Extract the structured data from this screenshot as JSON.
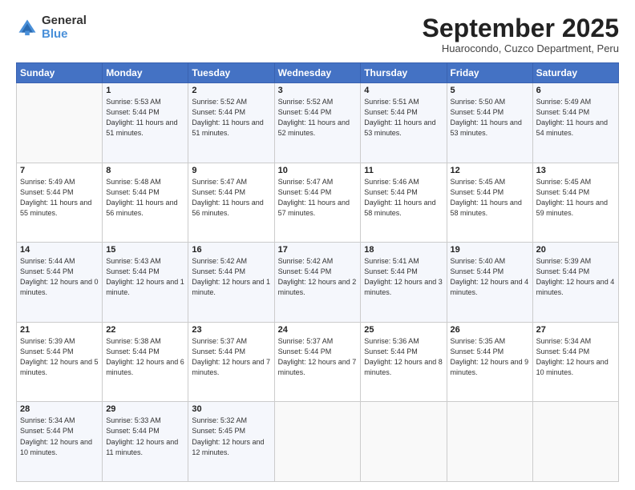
{
  "header": {
    "logo_general": "General",
    "logo_blue": "Blue",
    "month_title": "September 2025",
    "subtitle": "Huarocondo, Cuzco Department, Peru"
  },
  "calendar": {
    "days_of_week": [
      "Sunday",
      "Monday",
      "Tuesday",
      "Wednesday",
      "Thursday",
      "Friday",
      "Saturday"
    ],
    "weeks": [
      [
        {
          "day": "",
          "sunrise": "",
          "sunset": "",
          "daylight": ""
        },
        {
          "day": "1",
          "sunrise": "Sunrise: 5:53 AM",
          "sunset": "Sunset: 5:44 PM",
          "daylight": "Daylight: 11 hours and 51 minutes."
        },
        {
          "day": "2",
          "sunrise": "Sunrise: 5:52 AM",
          "sunset": "Sunset: 5:44 PM",
          "daylight": "Daylight: 11 hours and 51 minutes."
        },
        {
          "day": "3",
          "sunrise": "Sunrise: 5:52 AM",
          "sunset": "Sunset: 5:44 PM",
          "daylight": "Daylight: 11 hours and 52 minutes."
        },
        {
          "day": "4",
          "sunrise": "Sunrise: 5:51 AM",
          "sunset": "Sunset: 5:44 PM",
          "daylight": "Daylight: 11 hours and 53 minutes."
        },
        {
          "day": "5",
          "sunrise": "Sunrise: 5:50 AM",
          "sunset": "Sunset: 5:44 PM",
          "daylight": "Daylight: 11 hours and 53 minutes."
        },
        {
          "day": "6",
          "sunrise": "Sunrise: 5:49 AM",
          "sunset": "Sunset: 5:44 PM",
          "daylight": "Daylight: 11 hours and 54 minutes."
        }
      ],
      [
        {
          "day": "7",
          "sunrise": "Sunrise: 5:49 AM",
          "sunset": "Sunset: 5:44 PM",
          "daylight": "Daylight: 11 hours and 55 minutes."
        },
        {
          "day": "8",
          "sunrise": "Sunrise: 5:48 AM",
          "sunset": "Sunset: 5:44 PM",
          "daylight": "Daylight: 11 hours and 56 minutes."
        },
        {
          "day": "9",
          "sunrise": "Sunrise: 5:47 AM",
          "sunset": "Sunset: 5:44 PM",
          "daylight": "Daylight: 11 hours and 56 minutes."
        },
        {
          "day": "10",
          "sunrise": "Sunrise: 5:47 AM",
          "sunset": "Sunset: 5:44 PM",
          "daylight": "Daylight: 11 hours and 57 minutes."
        },
        {
          "day": "11",
          "sunrise": "Sunrise: 5:46 AM",
          "sunset": "Sunset: 5:44 PM",
          "daylight": "Daylight: 11 hours and 58 minutes."
        },
        {
          "day": "12",
          "sunrise": "Sunrise: 5:45 AM",
          "sunset": "Sunset: 5:44 PM",
          "daylight": "Daylight: 11 hours and 58 minutes."
        },
        {
          "day": "13",
          "sunrise": "Sunrise: 5:45 AM",
          "sunset": "Sunset: 5:44 PM",
          "daylight": "Daylight: 11 hours and 59 minutes."
        }
      ],
      [
        {
          "day": "14",
          "sunrise": "Sunrise: 5:44 AM",
          "sunset": "Sunset: 5:44 PM",
          "daylight": "Daylight: 12 hours and 0 minutes."
        },
        {
          "day": "15",
          "sunrise": "Sunrise: 5:43 AM",
          "sunset": "Sunset: 5:44 PM",
          "daylight": "Daylight: 12 hours and 1 minute."
        },
        {
          "day": "16",
          "sunrise": "Sunrise: 5:42 AM",
          "sunset": "Sunset: 5:44 PM",
          "daylight": "Daylight: 12 hours and 1 minute."
        },
        {
          "day": "17",
          "sunrise": "Sunrise: 5:42 AM",
          "sunset": "Sunset: 5:44 PM",
          "daylight": "Daylight: 12 hours and 2 minutes."
        },
        {
          "day": "18",
          "sunrise": "Sunrise: 5:41 AM",
          "sunset": "Sunset: 5:44 PM",
          "daylight": "Daylight: 12 hours and 3 minutes."
        },
        {
          "day": "19",
          "sunrise": "Sunrise: 5:40 AM",
          "sunset": "Sunset: 5:44 PM",
          "daylight": "Daylight: 12 hours and 4 minutes."
        },
        {
          "day": "20",
          "sunrise": "Sunrise: 5:39 AM",
          "sunset": "Sunset: 5:44 PM",
          "daylight": "Daylight: 12 hours and 4 minutes."
        }
      ],
      [
        {
          "day": "21",
          "sunrise": "Sunrise: 5:39 AM",
          "sunset": "Sunset: 5:44 PM",
          "daylight": "Daylight: 12 hours and 5 minutes."
        },
        {
          "day": "22",
          "sunrise": "Sunrise: 5:38 AM",
          "sunset": "Sunset: 5:44 PM",
          "daylight": "Daylight: 12 hours and 6 minutes."
        },
        {
          "day": "23",
          "sunrise": "Sunrise: 5:37 AM",
          "sunset": "Sunset: 5:44 PM",
          "daylight": "Daylight: 12 hours and 7 minutes."
        },
        {
          "day": "24",
          "sunrise": "Sunrise: 5:37 AM",
          "sunset": "Sunset: 5:44 PM",
          "daylight": "Daylight: 12 hours and 7 minutes."
        },
        {
          "day": "25",
          "sunrise": "Sunrise: 5:36 AM",
          "sunset": "Sunset: 5:44 PM",
          "daylight": "Daylight: 12 hours and 8 minutes."
        },
        {
          "day": "26",
          "sunrise": "Sunrise: 5:35 AM",
          "sunset": "Sunset: 5:44 PM",
          "daylight": "Daylight: 12 hours and 9 minutes."
        },
        {
          "day": "27",
          "sunrise": "Sunrise: 5:34 AM",
          "sunset": "Sunset: 5:44 PM",
          "daylight": "Daylight: 12 hours and 10 minutes."
        }
      ],
      [
        {
          "day": "28",
          "sunrise": "Sunrise: 5:34 AM",
          "sunset": "Sunset: 5:44 PM",
          "daylight": "Daylight: 12 hours and 10 minutes."
        },
        {
          "day": "29",
          "sunrise": "Sunrise: 5:33 AM",
          "sunset": "Sunset: 5:44 PM",
          "daylight": "Daylight: 12 hours and 11 minutes."
        },
        {
          "day": "30",
          "sunrise": "Sunrise: 5:32 AM",
          "sunset": "Sunset: 5:45 PM",
          "daylight": "Daylight: 12 hours and 12 minutes."
        },
        {
          "day": "",
          "sunrise": "",
          "sunset": "",
          "daylight": ""
        },
        {
          "day": "",
          "sunrise": "",
          "sunset": "",
          "daylight": ""
        },
        {
          "day": "",
          "sunrise": "",
          "sunset": "",
          "daylight": ""
        },
        {
          "day": "",
          "sunrise": "",
          "sunset": "",
          "daylight": ""
        }
      ]
    ]
  }
}
